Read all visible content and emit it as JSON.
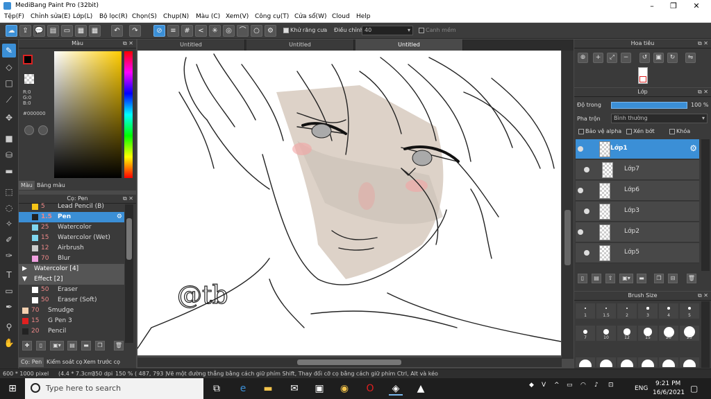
{
  "window": {
    "title": "MediBang Paint Pro (32bit)"
  },
  "menu": [
    "Tệp(F)",
    "Chỉnh sửa(E)",
    "Lớp(L)",
    "Bộ lọc(R)",
    "Chọn(S)",
    "Chụp(N)",
    "Màu (C)",
    "Xem(V)",
    "Công cụ(T)",
    "Cửa sổ(W)",
    "Cloud",
    "Help"
  ],
  "toolbar": {
    "antialias_label": "Khử răng cưa",
    "adjust_label": "Điều chỉnh",
    "adjust_value": "40",
    "smoothing_label": "Canh mềm"
  },
  "color_panel": {
    "title": "Màu",
    "r": "R:0",
    "g": "G:0",
    "b": "B:0",
    "hex": "#000000",
    "tab_color": "Màu",
    "tab_palette": "Bảng màu",
    "fg_color": "#000000"
  },
  "brush_panel": {
    "title": "Cọ: Pen",
    "items": [
      {
        "size": "5",
        "name": "Lead Pencil (B)",
        "color": "#f5c518"
      },
      {
        "size": "1.5",
        "name": "Pen",
        "color": "#222222",
        "selected": true
      },
      {
        "size": "25",
        "name": "Watercolor",
        "color": "#7fd6f0"
      },
      {
        "size": "15",
        "name": "Watercolor (Wet)",
        "color": "#7fd6f0"
      },
      {
        "size": "12",
        "name": "Airbrush",
        "color": "#cccccc"
      },
      {
        "size": "70",
        "name": "Blur",
        "color": "#f0a0e0"
      }
    ],
    "group_watercolor": "Watercolor [4]",
    "group_effect": "Effect [2]",
    "effect_items": [
      {
        "size": "50",
        "name": "Eraser",
        "color": "#ffffff"
      },
      {
        "size": "50",
        "name": "Eraser (Soft)",
        "color": "#ffffff"
      }
    ],
    "other_items": [
      {
        "size": "70",
        "name": "Smudge",
        "color": "#f3d0b0"
      },
      {
        "size": "15",
        "name": "G Pen 3",
        "color": "#e02020"
      },
      {
        "size": "20",
        "name": "Pencil",
        "color": "#222222"
      }
    ],
    "tab_brush": "Cọ: Pen",
    "tab_check": "Kiểm soát cọ",
    "tab_preview": "Xem trước cọ"
  },
  "doc_tabs": [
    "Untitled",
    "Untitled",
    "Untitled"
  ],
  "canvas": {
    "signature": "@tb"
  },
  "navigator": {
    "title": "Hoa tiêu"
  },
  "layer_panel": {
    "title": "Lớp",
    "opacity_label": "Độ trong",
    "opacity_value": "100 %",
    "blend_label": "Pha trộn",
    "blend_value": "Bình thường",
    "protect_alpha": "Bảo vệ alpha",
    "clip": "Xén bớt",
    "lock": "Khóa",
    "layers": [
      "Lớp1",
      "Lớp7",
      "Lớp6",
      "Lớp3",
      "Lớp2",
      "Lớp5"
    ]
  },
  "brush_size": {
    "title": "Brush Size",
    "sizes": [
      "1",
      "1.5",
      "2",
      "3",
      "4",
      "5",
      "7",
      "10",
      "12",
      "15",
      "20",
      "25"
    ]
  },
  "status": {
    "dims": "600 * 1000 pixel",
    "cm": "(4.4 * 7.3cm)",
    "dpi": "350 dpi",
    "zoom": "150 %",
    "coords": "( 487, 793 )",
    "hint": "Vẽ một đường thẳng bằng cách giữ phím Shift, Thay đổi cỡ cọ bằng cách giữ phím Ctrl, Alt và kéo"
  },
  "taskbar": {
    "search_placeholder": "Type here to search",
    "lang": "ENG",
    "time": "9:21 PM",
    "date": "16/6/2021"
  }
}
